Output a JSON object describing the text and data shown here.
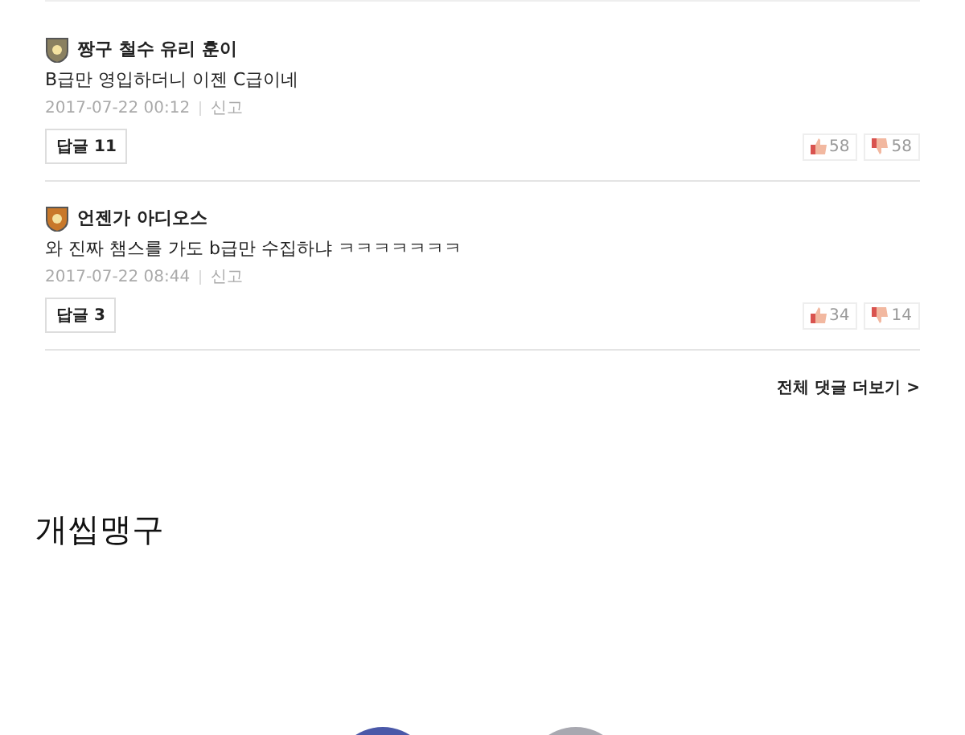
{
  "comments": [
    {
      "author": "짱구 철수 유리 훈이",
      "color": "#8a8060",
      "text": "B급만 영입하더니 이젠 C급이네",
      "date": "2017-07-22 00:12",
      "report": "신고",
      "reply": "답글 11",
      "likes": "58",
      "dislikes": "58"
    },
    {
      "author": "언젠가 아디오스",
      "color": "#c8782a",
      "text": "와 진짜 챔스를 가도 b급만 수집하냐 ㅋㅋㅋㅋㅋㅋㅋ",
      "date": "2017-07-22 08:44",
      "report": "신고",
      "reply": "답글 3",
      "likes": "34",
      "dislikes": "14"
    }
  ],
  "more_link": "전체 댓글 더보기 >",
  "username": "개씹맹구"
}
